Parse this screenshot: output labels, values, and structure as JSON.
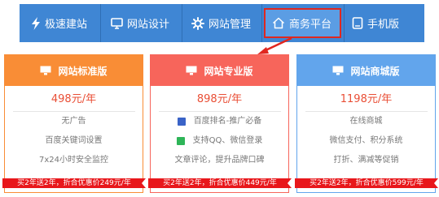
{
  "nav": {
    "items": [
      {
        "label": "极速建站",
        "icon": "lightning-icon"
      },
      {
        "label": "网站设计",
        "icon": "monitor-icon"
      },
      {
        "label": "网站管理",
        "icon": "gear-icon"
      },
      {
        "label": "商务平台",
        "icon": "home-icon",
        "active": true
      },
      {
        "label": "手机版",
        "icon": "phone-icon"
      }
    ]
  },
  "plans": [
    {
      "title": "网站标准版",
      "price": "498元/年",
      "features": [
        "无广告",
        "百度关键词设置",
        "7x24小时安全监控"
      ],
      "promo": "买2年送2年，折合优惠价249元/年",
      "color": "#f98d36"
    },
    {
      "title": "网站专业版",
      "price": "898元/年",
      "features": [
        "百度排名-推广必备",
        "支持QQ、微信登录",
        "文章评论，提升品牌口碑"
      ],
      "promo": "买2年送2年，折合优惠价449元/年",
      "color": "#f7655b"
    },
    {
      "title": "网站商城版",
      "price": "1198元/年",
      "features": [
        "在线商城",
        "微信支付、积分系统",
        "打折、满减等促销"
      ],
      "promo": "买2年送2年，折合优惠价599元/年",
      "color": "#62a5ec"
    }
  ],
  "colors": {
    "nav_bg": "#3f86d4",
    "nav_active_bg": "#5b9de4",
    "highlight": "#e0271f",
    "price": "#e94e35",
    "ribbon": "#e8171b"
  }
}
